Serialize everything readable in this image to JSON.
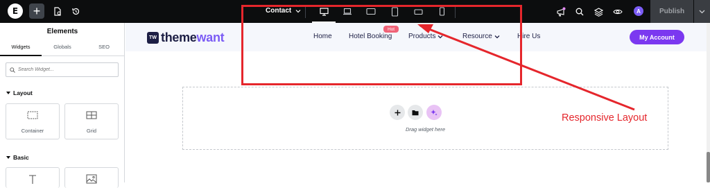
{
  "topbar": {
    "logo_glyph": "E",
    "add_glyph": "+",
    "document_title": "Contact",
    "publish_label": "Publish",
    "avatar_initial": "A",
    "devices": [
      {
        "name": "desktop",
        "active": true
      },
      {
        "name": "laptop",
        "active": false
      },
      {
        "name": "tablet-landscape",
        "active": false
      },
      {
        "name": "tablet-portrait",
        "active": false
      },
      {
        "name": "mobile-landscape",
        "active": false
      },
      {
        "name": "mobile-portrait",
        "active": false
      }
    ]
  },
  "panel": {
    "title": "Elements",
    "tabs": [
      "Widgets",
      "Globals",
      "SEO"
    ],
    "search_placeholder": "Search Widget...",
    "sections": [
      {
        "label": "Layout",
        "widgets": [
          "Container",
          "Grid"
        ]
      },
      {
        "label": "Basic",
        "widgets": [
          "",
          ""
        ]
      }
    ]
  },
  "site": {
    "brand_badge": "TW",
    "brand_main": "theme",
    "brand_accent": "want",
    "nav": [
      {
        "label": "Home",
        "dropdown": false
      },
      {
        "label": "Hotel Booking",
        "dropdown": false
      },
      {
        "label": "Products",
        "dropdown": true
      },
      {
        "label": "Resource",
        "dropdown": true
      },
      {
        "label": "Hire Us",
        "dropdown": false
      }
    ],
    "hot_badge": "Hot",
    "account_button": "My Account"
  },
  "dropzone": {
    "text": "Drag widget here"
  },
  "annotation": {
    "label": "Responsive Layout",
    "color": "#e5262c"
  },
  "colors": {
    "topbar": "#0c0d0e",
    "accent_purple": "#7b38f0",
    "brand_navy": "#1d1f45",
    "hot_badge": "#f06277"
  }
}
